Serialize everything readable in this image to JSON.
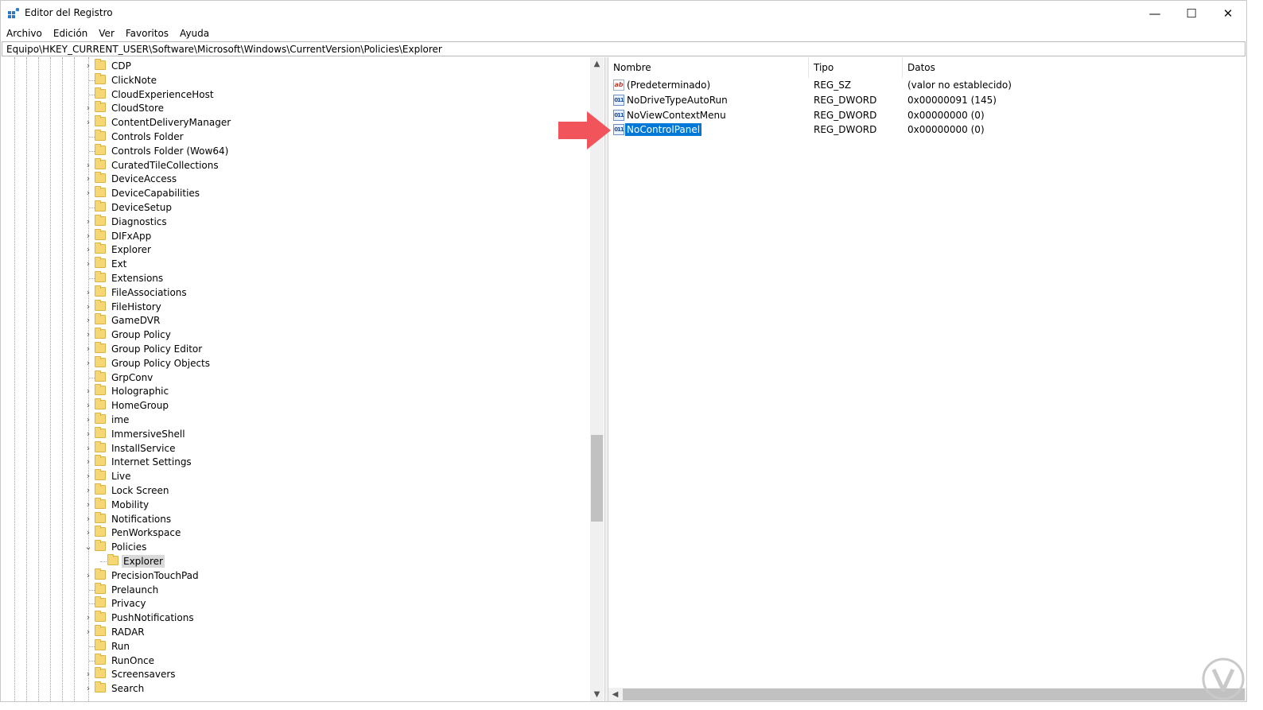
{
  "window": {
    "title": "Editor del Registro",
    "controls": {
      "minimize": "—",
      "maximize": "☐",
      "close": "✕"
    }
  },
  "menu": [
    "Archivo",
    "Edición",
    "Ver",
    "Favoritos",
    "Ayuda"
  ],
  "address": "Equipo\\HKEY_CURRENT_USER\\Software\\Microsoft\\Windows\\CurrentVersion\\Policies\\Explorer",
  "tree": {
    "items": [
      {
        "label": "CDP",
        "expandable": true
      },
      {
        "label": "ClickNote",
        "expandable": false
      },
      {
        "label": "CloudExperienceHost",
        "expandable": false
      },
      {
        "label": "CloudStore",
        "expandable": true
      },
      {
        "label": "ContentDeliveryManager",
        "expandable": true
      },
      {
        "label": "Controls Folder",
        "expandable": false
      },
      {
        "label": "Controls Folder (Wow64)",
        "expandable": false
      },
      {
        "label": "CuratedTileCollections",
        "expandable": true
      },
      {
        "label": "DeviceAccess",
        "expandable": true
      },
      {
        "label": "DeviceCapabilities",
        "expandable": true
      },
      {
        "label": "DeviceSetup",
        "expandable": false
      },
      {
        "label": "Diagnostics",
        "expandable": true
      },
      {
        "label": "DIFxApp",
        "expandable": true
      },
      {
        "label": "Explorer",
        "expandable": true
      },
      {
        "label": "Ext",
        "expandable": true
      },
      {
        "label": "Extensions",
        "expandable": false
      },
      {
        "label": "FileAssociations",
        "expandable": true
      },
      {
        "label": "FileHistory",
        "expandable": true
      },
      {
        "label": "GameDVR",
        "expandable": true
      },
      {
        "label": "Group Policy",
        "expandable": true
      },
      {
        "label": "Group Policy Editor",
        "expandable": true
      },
      {
        "label": "Group Policy Objects",
        "expandable": true
      },
      {
        "label": "GrpConv",
        "expandable": false
      },
      {
        "label": "Holographic",
        "expandable": true
      },
      {
        "label": "HomeGroup",
        "expandable": true
      },
      {
        "label": "ime",
        "expandable": true
      },
      {
        "label": "ImmersiveShell",
        "expandable": true
      },
      {
        "label": "InstallService",
        "expandable": true
      },
      {
        "label": "Internet Settings",
        "expandable": true
      },
      {
        "label": "Live",
        "expandable": true
      },
      {
        "label": "Lock Screen",
        "expandable": true
      },
      {
        "label": "Mobility",
        "expandable": true
      },
      {
        "label": "Notifications",
        "expandable": true
      },
      {
        "label": "PenWorkspace",
        "expandable": true
      },
      {
        "label": "Policies",
        "expandable": true,
        "expanded": true
      },
      {
        "label": "Explorer",
        "expandable": false,
        "child": true,
        "selected": true
      },
      {
        "label": "PrecisionTouchPad",
        "expandable": true
      },
      {
        "label": "Prelaunch",
        "expandable": false
      },
      {
        "label": "Privacy",
        "expandable": false
      },
      {
        "label": "PushNotifications",
        "expandable": true
      },
      {
        "label": "RADAR",
        "expandable": true
      },
      {
        "label": "Run",
        "expandable": false
      },
      {
        "label": "RunOnce",
        "expandable": false
      },
      {
        "label": "Screensavers",
        "expandable": true
      },
      {
        "label": "Search",
        "expandable": true
      }
    ]
  },
  "list": {
    "headers": {
      "name": "Nombre",
      "type": "Tipo",
      "data": "Datos"
    },
    "rows": [
      {
        "icon": "ab",
        "name": "(Predeterminado)",
        "type": "REG_SZ",
        "data": "(valor no establecido)",
        "selected": false
      },
      {
        "icon": "011",
        "name": "NoDriveTypeAutoRun",
        "type": "REG_DWORD",
        "data": "0x00000091 (145)",
        "selected": false
      },
      {
        "icon": "011",
        "name": "NoViewContextMenu",
        "type": "REG_DWORD",
        "data": "0x00000000 (0)",
        "selected": false
      },
      {
        "icon": "011",
        "name": "NoControlPanel",
        "type": "REG_DWORD",
        "data": "0x00000000 (0)",
        "selected": true
      }
    ]
  },
  "colors": {
    "selection": "#0078d7",
    "arrow": "#f2545b",
    "folder": "#f6d775"
  },
  "scroll": {
    "tree_up": "▲",
    "tree_down": "▼",
    "list_left": "◀"
  }
}
